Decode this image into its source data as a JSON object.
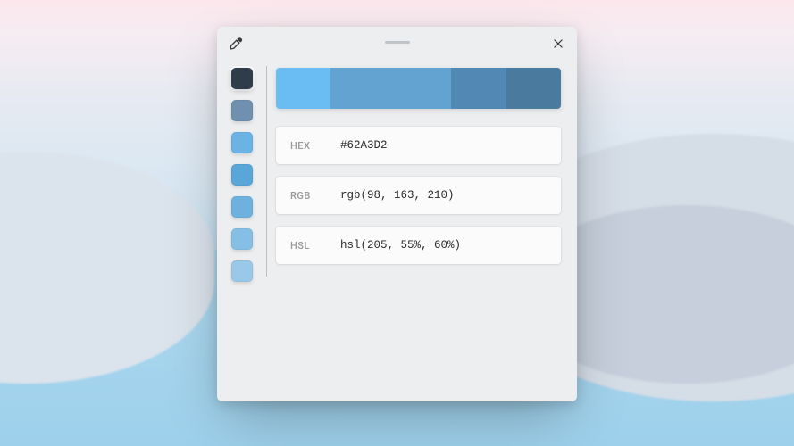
{
  "history_swatches": [
    {
      "id": "dark-slate",
      "color": "#2f3d4b",
      "selected": true
    },
    {
      "id": "steel",
      "color": "#6f91af",
      "selected": false
    },
    {
      "id": "sky",
      "color": "#6bb2e5",
      "selected": false
    },
    {
      "id": "picton",
      "color": "#5aa6d8",
      "selected": false
    },
    {
      "id": "carolina",
      "color": "#6fb1de",
      "selected": false
    },
    {
      "id": "light1",
      "color": "#86bfe5",
      "selected": false
    },
    {
      "id": "light2",
      "color": "#9ac8e8",
      "selected": false
    }
  ],
  "shades": [
    {
      "color": "#6abdf2"
    },
    {
      "color": "#62a3d2",
      "wide": true
    },
    {
      "color": "#5189b4"
    },
    {
      "color": "#4a7a9d"
    }
  ],
  "values": {
    "hex": {
      "label": "HEX",
      "value": "#62A3D2"
    },
    "rgb": {
      "label": "RGB",
      "value": "rgb(98, 163, 210)"
    },
    "hsl": {
      "label": "HSL",
      "value": "hsl(205, 55%, 60%)"
    }
  }
}
